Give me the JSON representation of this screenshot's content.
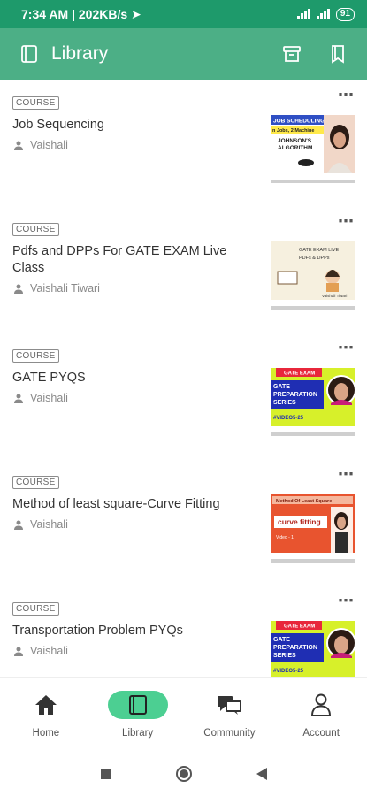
{
  "status_bar": {
    "time": "7:34 AM",
    "speed": "202KB/s",
    "battery": "91"
  },
  "app_bar": {
    "title": "Library"
  },
  "courses": [
    {
      "badge": "COURSE",
      "title": "Job Sequencing",
      "author": "Vaishali",
      "thumb": {
        "line1": "JOB SCHEDULING",
        "line2": "n Jobs, 2 Machine",
        "line3": "JOHNSON'S",
        "line4": "ALGORITHM"
      }
    },
    {
      "badge": "COURSE",
      "title": "Pdfs and DPPs For GATE EXAM Live Class",
      "author": "Vaishali Tiwari",
      "thumb": {
        "line1": "GATE EXAM LIVE",
        "line2": "PDFs & DPPs",
        "line3": "Vaishali Tiwari"
      }
    },
    {
      "badge": "COURSE",
      "title": "GATE PYQS",
      "author": "Vaishali",
      "thumb": {
        "line1": "GATE EXAM",
        "line2": "GATE",
        "line3": "PREPARATION",
        "line4": "SERIES",
        "line5": "#VIDEO5-25"
      }
    },
    {
      "badge": "COURSE",
      "title": "Method of least square-Curve Fitting",
      "author": "Vaishali",
      "thumb": {
        "line1": "Method Of Least Square",
        "line2": "curve fitting",
        "line3": "Video - 1"
      }
    },
    {
      "badge": "COURSE",
      "title": "Transportation Problem PYQs",
      "author": "Vaishali",
      "thumb": {
        "line1": "GATE EXAM",
        "line2": "GATE",
        "line3": "PREPARATION",
        "line4": "SERIES",
        "line5": "#VIDEO5-25"
      }
    }
  ],
  "bottom_nav": {
    "home": "Home",
    "library": "Library",
    "community": "Community",
    "account": "Account"
  },
  "colors": {
    "status_bar": "#1e9a6b",
    "app_bar": "#4caf86",
    "nav_active": "#4ccf92"
  }
}
